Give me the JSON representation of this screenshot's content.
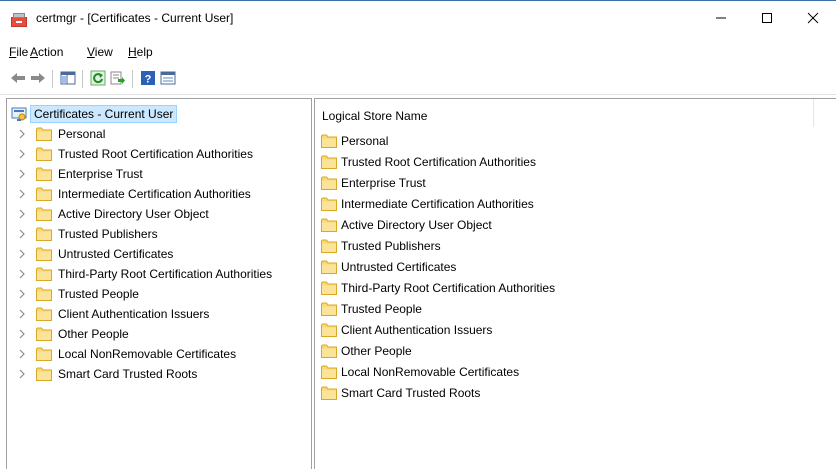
{
  "window": {
    "title": "certmgr - [Certificates - Current User]",
    "controls": [
      "minimize",
      "maximize",
      "close"
    ]
  },
  "menu": [
    {
      "underline": "F",
      "rest": "ile"
    },
    {
      "underline": "A",
      "rest": "ction"
    },
    {
      "underline": "V",
      "rest": "iew"
    },
    {
      "underline": "H",
      "rest": "elp"
    }
  ],
  "toolbar": {
    "icons": [
      "back-arrow-icon",
      "forward-arrow-icon",
      "show-hide-console-tree-icon",
      "refresh-icon",
      "export-list-icon",
      "help-icon",
      "properties-icon"
    ]
  },
  "tree": {
    "root_label": "Certificates - Current User",
    "items": [
      "Personal",
      "Trusted Root Certification Authorities",
      "Enterprise Trust",
      "Intermediate Certification Authorities",
      "Active Directory User Object",
      "Trusted Publishers",
      "Untrusted Certificates",
      "Third-Party Root Certification Authorities",
      "Trusted People",
      "Client Authentication Issuers",
      "Other People",
      "Local NonRemovable Certificates",
      "Smart Card Trusted Roots"
    ]
  },
  "list": {
    "column_header": "Logical Store Name",
    "items": [
      "Personal",
      "Trusted Root Certification Authorities",
      "Enterprise Trust",
      "Intermediate Certification Authorities",
      "Active Directory User Object",
      "Trusted Publishers",
      "Untrusted Certificates",
      "Third-Party Root Certification Authorities",
      "Trusted People",
      "Client Authentication Issuers",
      "Other People",
      "Local NonRemovable Certificates",
      "Smart Card Trusted Roots"
    ]
  },
  "colors": {
    "selection_fill": "#cce8ff",
    "selection_border": "#99d1ff",
    "folder_fill": "#f8d775",
    "folder_edge": "#d9a826",
    "pane_border": "#a0a0a0"
  }
}
